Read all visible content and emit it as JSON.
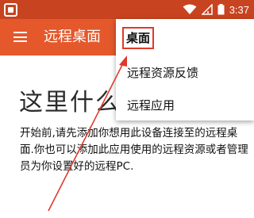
{
  "status_bar": {
    "time": "3:37"
  },
  "app_bar": {
    "title": "远程桌面"
  },
  "content": {
    "heading": "这里什么",
    "body": "开始前,请先添加你想用此设备连接至的远程桌面.你也可以添加此应用使用的远程资源或者管理员为你设置好的远程PC."
  },
  "dropdown_menu": {
    "items": [
      {
        "label": "桌面",
        "highlighted": true
      },
      {
        "label": "远程资源反馈"
      },
      {
        "label": "远程应用"
      }
    ]
  },
  "colors": {
    "status_bar": "#c8431f",
    "app_bar": "#e4582b",
    "highlight_annotation": "#e0392b"
  },
  "icons": {
    "app": "app-square-icon",
    "menu": "hamburger-menu-icon",
    "wifi": "wifi-icon",
    "signal": "cell-signal-icon",
    "battery": "battery-icon"
  }
}
